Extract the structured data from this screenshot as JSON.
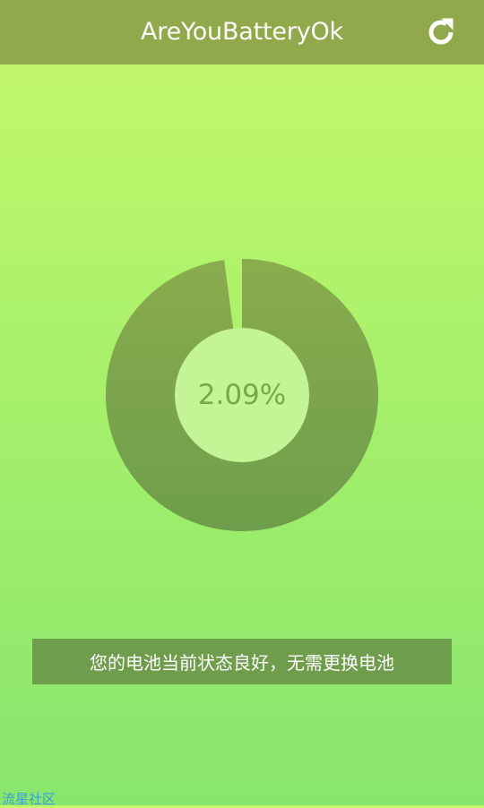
{
  "app_bar": {
    "title": "AreYouBatteryOk",
    "refresh_icon": "refresh-icon",
    "background": "#90a94a"
  },
  "gauge": {
    "percent_label": "2.09%",
    "fraction": 0.0209,
    "ring_color_top": "#8aac4d",
    "ring_color_bottom": "#6e9e4b",
    "center_color": "#c3f495",
    "label_color": "#79a84b"
  },
  "status": {
    "message": "您的电池当前状态良好，无需更换电池",
    "background": "#6e9e4b"
  },
  "watermark": {
    "text": "流星社区"
  },
  "colors": {
    "background_top": "#c6f86a",
    "background_bottom": "#88e56e"
  }
}
